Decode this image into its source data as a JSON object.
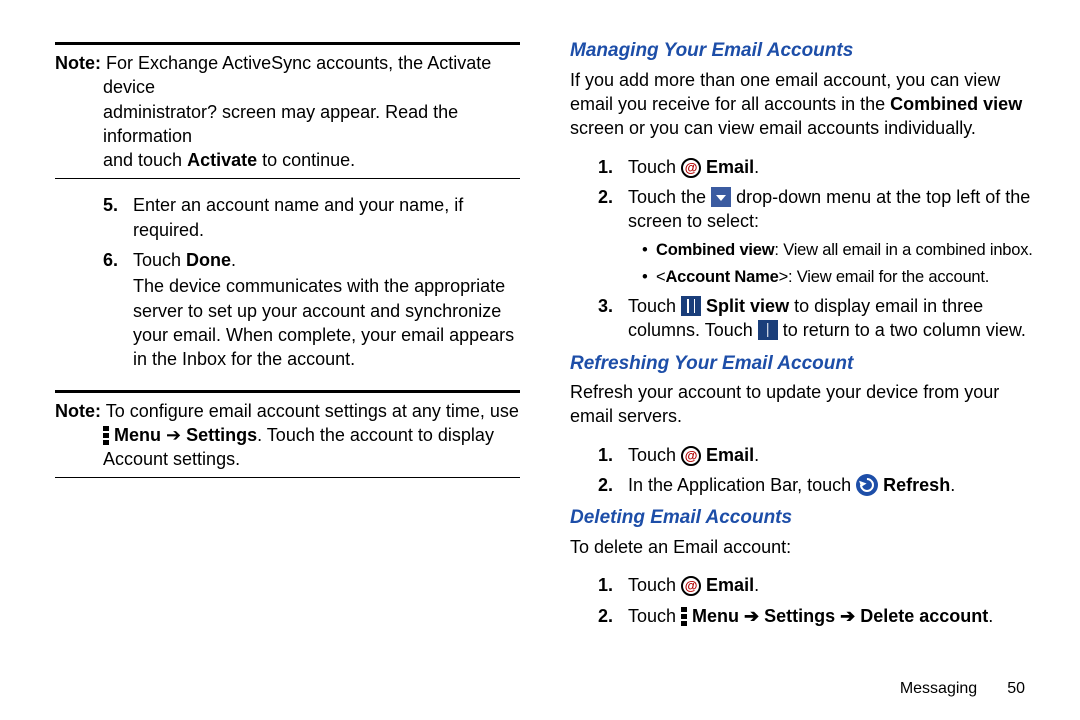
{
  "left": {
    "note1_label": "Note:",
    "note1_l1": "For Exchange ActiveSync accounts, the Activate device",
    "note1_l2": "administrator? screen may appear. Read the information",
    "note1_l3a": "and touch ",
    "note1_l3b": "Activate",
    "note1_l3c": " to continue.",
    "s5_num": "5.",
    "s5": "Enter an account name and your name, if required.",
    "s6_num": "6.",
    "s6a": "Touch ",
    "s6b": "Done",
    "s6c": ".",
    "s6_p1": "The device communicates with the appropriate server to set up your account and synchronize your email. When complete, your email appears in the Inbox for the account.",
    "note2_label": "Note:",
    "note2_1": "To configure email account settings at any time, use",
    "note2_2a": "Menu",
    "note2_arrow": " ➔ ",
    "note2_2b": "Settings",
    "note2_2c": ". Touch the account to display",
    "note2_3": "Account settings."
  },
  "right": {
    "h1": "Managing Your Email Accounts",
    "p1a": "If you add more than one email account, you can view email you receive for all accounts in the ",
    "p1b": "Combined view",
    "p1c": " screen or you can view email accounts individually.",
    "m1_num": "1.",
    "m1a": "Touch ",
    "m1b": " Email",
    "m1c": ".",
    "m2_num": "2.",
    "m2a": "Touch the ",
    "m2b": " drop-down menu at the top left of the screen to select:",
    "mb1a": "Combined view",
    "mb1b": ": View all email in a combined inbox.",
    "mb2a": "<",
    "mb2b": "Account Name",
    "mb2c": ">: View email for the account.",
    "m3_num": "3.",
    "m3a": "Touch ",
    "m3b": " Split view",
    "m3c": " to display email in three columns. Touch ",
    "m3d": " to return to a two column view.",
    "h2": "Refreshing Your Email Account",
    "p2": "Refresh your account to update your device from your email servers.",
    "r1_num": "1.",
    "r1a": "Touch ",
    "r1b": " Email",
    "r1c": ".",
    "r2_num": "2.",
    "r2a": "In the Application Bar, touch ",
    "r2b": " Refresh",
    "r2c": ".",
    "h3": "Deleting Email Accounts",
    "p3": "To delete an Email account:",
    "d1_num": "1.",
    "d1a": "Touch ",
    "d1b": " Email",
    "d1c": ".",
    "d2_num": "2.",
    "d2a": "Touch ",
    "d2b": " Menu ➔ Settings ➔ Delete account",
    "d2c": "."
  },
  "footer": {
    "section": "Messaging",
    "page": "50"
  }
}
